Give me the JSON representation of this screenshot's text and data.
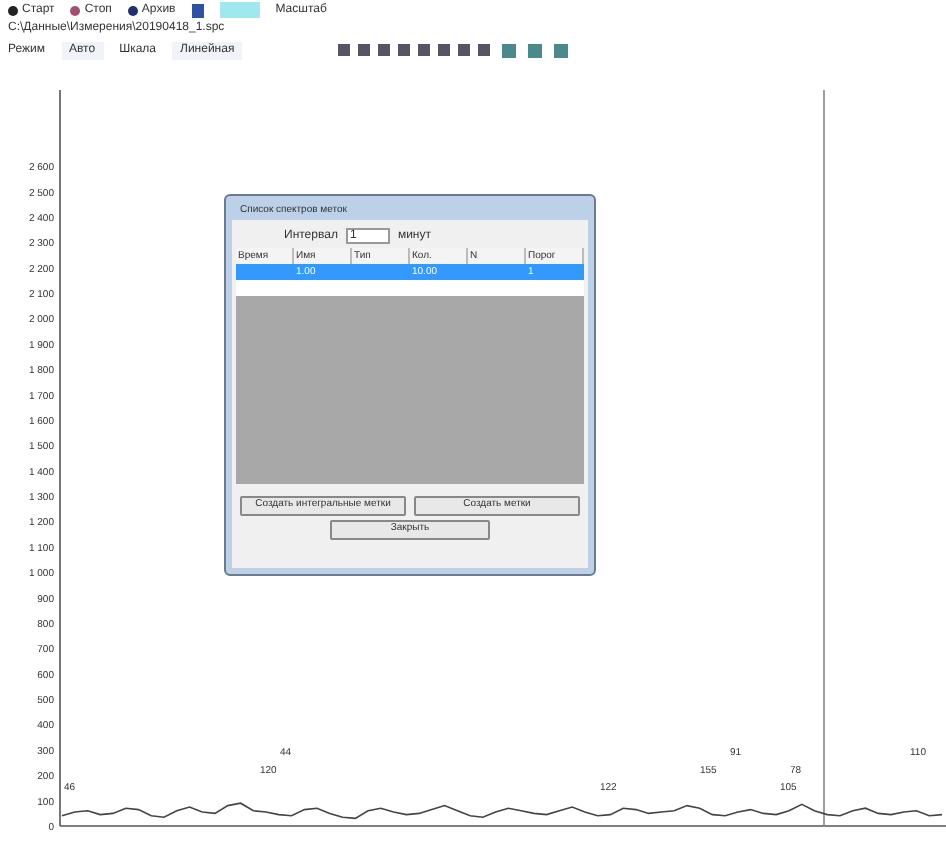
{
  "toolbar": {
    "items": [
      {
        "label": "Старт",
        "color": "#222222"
      },
      {
        "label": "Стоп",
        "color": "#a05070"
      },
      {
        "label": "Архив",
        "color": "#203070"
      }
    ],
    "zoom_label": "Масштаб"
  },
  "file_path": "C:\\Данные\\Измерения\\20190418_1.spc",
  "controls": {
    "mode_label": "Режим",
    "mode_value": "Авто",
    "scale_label": "Шкала",
    "scale_value": "Линейная"
  },
  "plot": {
    "chart_data": {
      "type": "line",
      "ylim": [
        0,
        2900
      ],
      "yticks": [
        {
          "value": 2600,
          "label": "2 600"
        },
        {
          "value": 2500,
          "label": "2 500"
        },
        {
          "value": 2400,
          "label": "2 400"
        },
        {
          "value": 2300,
          "label": "2 300"
        },
        {
          "value": 2200,
          "label": "2 200"
        },
        {
          "value": 2100,
          "label": "2 100"
        },
        {
          "value": 2000,
          "label": "2 000"
        },
        {
          "value": 1900,
          "label": "1 900"
        },
        {
          "value": 1800,
          "label": "1 800"
        },
        {
          "value": 1700,
          "label": "1 700"
        },
        {
          "value": 1600,
          "label": "1 600"
        },
        {
          "value": 1500,
          "label": "1 500"
        },
        {
          "value": 1400,
          "label": "1 400"
        },
        {
          "value": 1300,
          "label": "1 300"
        },
        {
          "value": 1200,
          "label": "1 200"
        },
        {
          "value": 1100,
          "label": "1 100"
        },
        {
          "value": 1000,
          "label": "1 000"
        },
        {
          "value": 900,
          "label": "900"
        },
        {
          "value": 800,
          "label": "800"
        },
        {
          "value": 700,
          "label": "700"
        },
        {
          "value": 600,
          "label": "600"
        },
        {
          "value": 500,
          "label": "500"
        },
        {
          "value": 400,
          "label": "400"
        },
        {
          "value": 300,
          "label": "300"
        },
        {
          "value": 200,
          "label": "200"
        },
        {
          "value": 100,
          "label": "100"
        },
        {
          "value": 0,
          "label": "0"
        }
      ],
      "series": [
        {
          "color": "#444444",
          "values": [
            40,
            55,
            60,
            45,
            50,
            70,
            65,
            40,
            35,
            60,
            75,
            55,
            50,
            80,
            90,
            60,
            55,
            45,
            40,
            65,
            70,
            50,
            35,
            30,
            60,
            70,
            55,
            45,
            50,
            65,
            80,
            60,
            40,
            35,
            55,
            70,
            60,
            50,
            45,
            60,
            75,
            55,
            40,
            45,
            70,
            65,
            50,
            55,
            60,
            80,
            70,
            45,
            40,
            55,
            65,
            50,
            45,
            60,
            85,
            60,
            45,
            40,
            60,
            70,
            50,
            45,
            55,
            60,
            40,
            45
          ]
        }
      ]
    },
    "peaks": [
      "46",
      "120",
      "44",
      "122",
      "155",
      "91",
      "105",
      "78",
      "110"
    ]
  },
  "dialog": {
    "title": "Список спектров меток",
    "interval_label": "Интервал",
    "interval_value": "1",
    "unit_label": "минут",
    "columns": [
      "Время",
      "Имя",
      "Тип",
      "Кол.",
      "N",
      "Порог"
    ],
    "rows": [
      {
        "cells": [
          "",
          "1.00",
          "",
          "10.00",
          "",
          "1"
        ],
        "selected": true
      },
      {
        "cells": [
          "",
          "",
          "",
          "",
          "",
          ""
        ],
        "selected": false
      }
    ],
    "buttons": [
      "Создать интегральные метки",
      "Создать метки"
    ],
    "close_button": "Закрыть"
  }
}
